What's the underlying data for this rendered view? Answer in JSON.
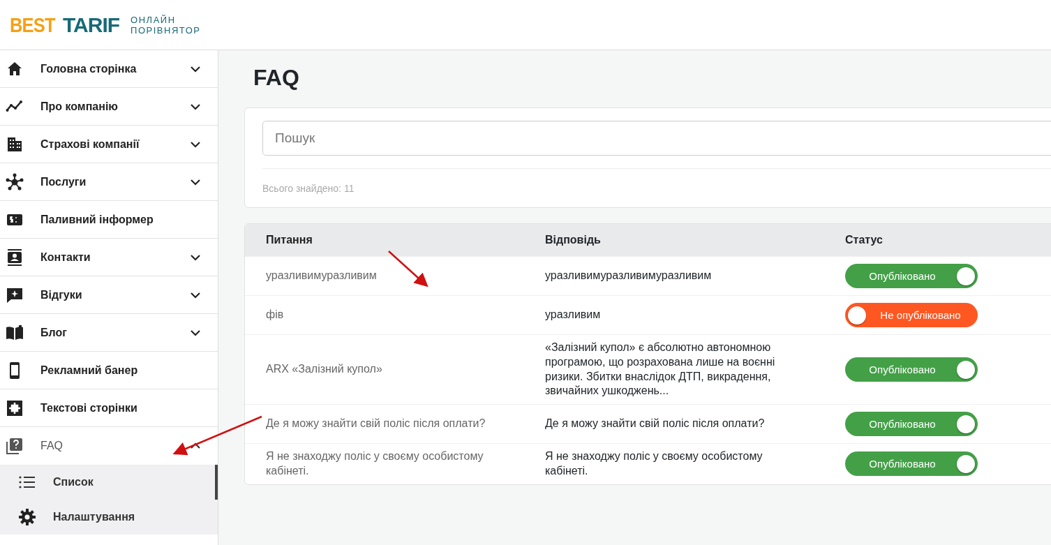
{
  "logo": {
    "brand_part_1": "BEST",
    "brand_part_2": "TARIF",
    "tagline_line_1": "ОНЛАЙН",
    "tagline_line_2": "ПОРІВНЯТОР"
  },
  "sidebar": {
    "items": [
      {
        "label": "Головна сторінка",
        "kind": "home",
        "expandable": true,
        "expanded": false
      },
      {
        "label": "Про компанію",
        "kind": "chart",
        "expandable": true,
        "expanded": false
      },
      {
        "label": "Страхові компанії",
        "kind": "building",
        "expandable": true,
        "expanded": false
      },
      {
        "label": "Послуги",
        "kind": "network",
        "expandable": true,
        "expanded": false
      },
      {
        "label": "Паливний інформер",
        "kind": "money",
        "expandable": false,
        "expanded": false
      },
      {
        "label": "Контакти",
        "kind": "contacts",
        "expandable": true,
        "expanded": false
      },
      {
        "label": "Відгуки",
        "kind": "review",
        "expandable": true,
        "expanded": false
      },
      {
        "label": "Блог",
        "kind": "book",
        "expandable": true,
        "expanded": false
      },
      {
        "label": "Рекламний банер",
        "kind": "phone",
        "expandable": false,
        "expanded": false
      },
      {
        "label": "Текстові сторінки",
        "kind": "pages",
        "expandable": false,
        "expanded": false
      },
      {
        "label": "FAQ",
        "kind": "faq",
        "expandable": true,
        "expanded": true,
        "children": [
          {
            "label": "Список",
            "kind": "list",
            "selected": true
          },
          {
            "label": "Налаштування",
            "kind": "gear",
            "selected": false
          }
        ]
      }
    ]
  },
  "page_title": "FAQ",
  "search": {
    "placeholder": "Пошук"
  },
  "found_count": "Всього знайдено: 11",
  "table": {
    "columns": [
      "Питання",
      "Відповідь",
      "Статус"
    ],
    "rows": [
      {
        "question": "уразливимуразливим",
        "answer": "уразливимуразливимуразливим",
        "status": "Опубліковано",
        "on": true
      },
      {
        "question": "фів",
        "answer": "уразливим",
        "status": "Не опубліковано",
        "on": false
      },
      {
        "question": "ARX «Залізний купол»",
        "answer": "«Залізний купол» є абсолютно автономною програмою, що розрахована лише на воєнні ризики. Збитки внаслідок ДТП, викрадення, звичайних ушкоджень...",
        "status": "Опубліковано",
        "on": true
      },
      {
        "question": "Де я можу знайти свій поліс після оплати?",
        "answer": "Де я можу знайти свій поліс після оплати?",
        "status": "Опубліковано",
        "on": true
      },
      {
        "question": "Я не знаходжу поліс у своєму особистому кабінеті.",
        "answer": "Я не знаходжу поліс у своєму особистому кабінеті.",
        "status": "Опубліковано",
        "on": true
      }
    ]
  }
}
